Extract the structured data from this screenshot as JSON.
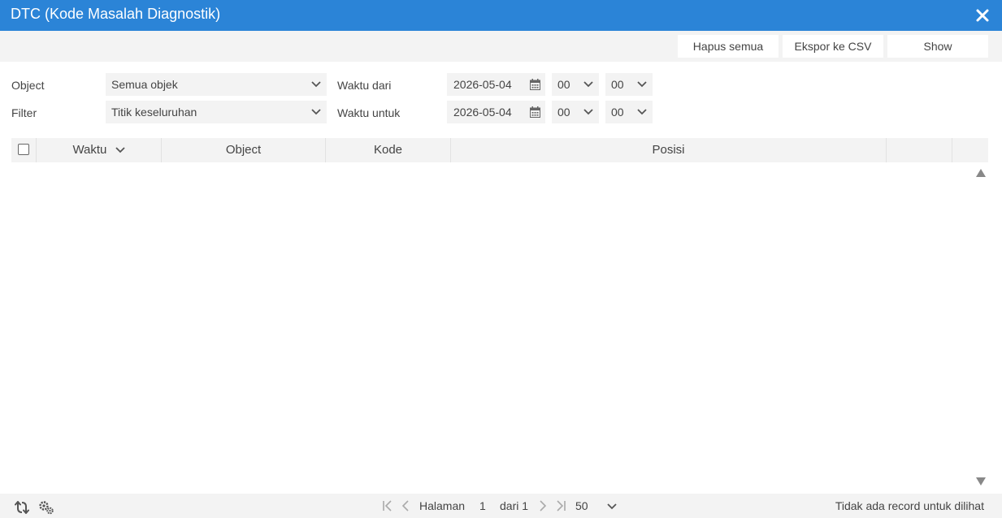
{
  "window": {
    "title": "DTC (Kode Masalah Diagnostik)"
  },
  "toolbar": {
    "clear_all": "Hapus semua",
    "export_csv": "Ekspor ke CSV",
    "show": "Show"
  },
  "filters": {
    "object_label": "Object",
    "object_value": "Semua objek",
    "filter_label": "Filter",
    "filter_value": "Titik keseluruhan",
    "time_from_label": "Waktu dari",
    "time_from_date": "2026-05-04",
    "time_from_hour": "00",
    "time_from_minute": "00",
    "time_to_label": "Waktu untuk",
    "time_to_date": "2026-05-04",
    "time_to_hour": "00",
    "time_to_minute": "00"
  },
  "grid": {
    "columns": [
      "Waktu",
      "Object",
      "Kode",
      "Posisi"
    ]
  },
  "pager": {
    "page_label": "Halaman",
    "page_current": "1",
    "page_of": "dari 1",
    "page_size": "50",
    "status": "Tidak ada record untuk dilihat"
  },
  "colors": {
    "titlebar": "#2b84d7",
    "panel": "#f3f3f3"
  }
}
